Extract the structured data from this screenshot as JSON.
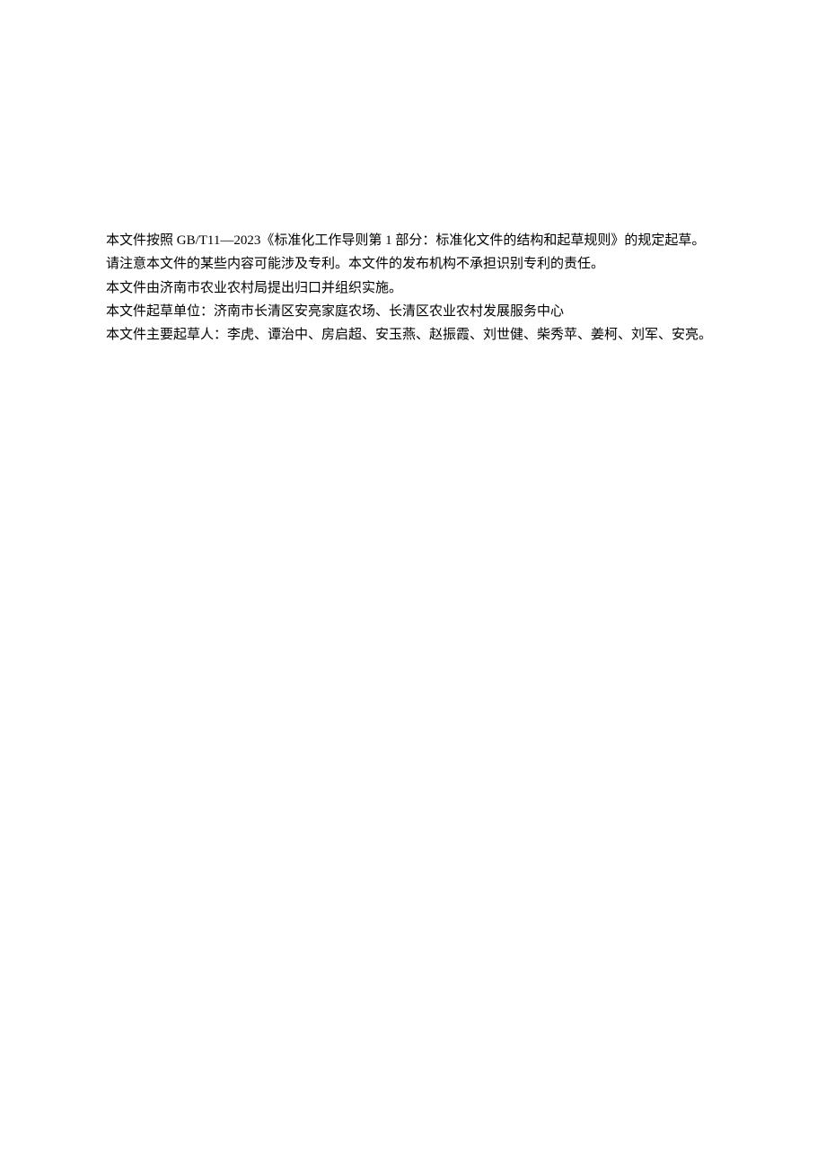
{
  "paragraphs": {
    "p1": "本文件按照 GB/T11—2023《标准化工作导则第 1 部分：标准化文件的结构和起草规则》的规定起草。",
    "p2": "请注意本文件的某些内容可能涉及专利。本文件的发布机构不承担识别专利的责任。",
    "p3": "本文件由济南市农业农村局提出归口并组织实施。",
    "p4": "本文件起草单位：济南市长清区安亮家庭农场、长清区农业农村发展服务中心",
    "p5": "本文件主要起草人：李虎、谭治中、房启超、安玉燕、赵振霞、刘世健、柴秀苹、姜柯、刘军、安亮。"
  }
}
